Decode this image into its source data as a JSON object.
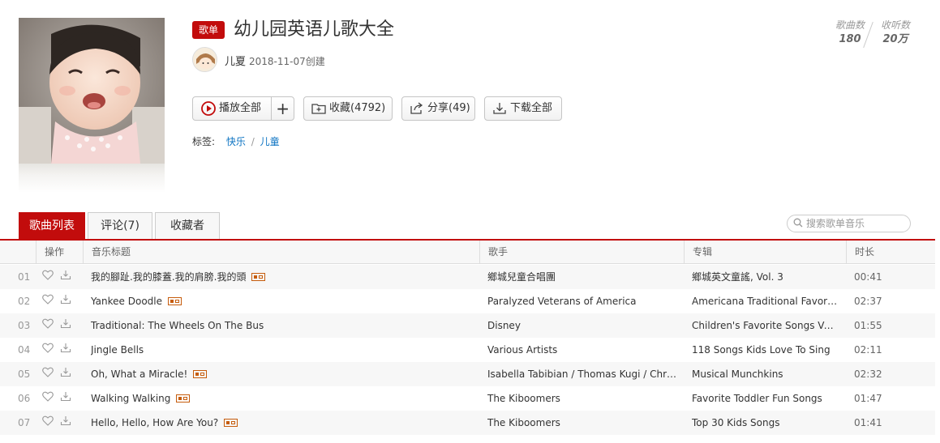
{
  "playlist": {
    "badge": "歌单",
    "title": "幼儿园英语儿歌大全",
    "creator": "儿夏",
    "created": "2018-11-07创建"
  },
  "stats": {
    "songs_label": "歌曲数",
    "songs_value": "180",
    "plays_label": "收听数",
    "plays_value": "20万"
  },
  "actions": {
    "play_all": "播放全部",
    "add": "+",
    "collect": "收藏(4792)",
    "share": "分享(49)",
    "download": "下载全部"
  },
  "tags": {
    "label": "标签:",
    "items": [
      "快乐",
      "儿童"
    ],
    "separator": "/"
  },
  "tabs": [
    "歌曲列表",
    "评论(7)",
    "收藏者"
  ],
  "search": {
    "placeholder": "搜索歌单音乐"
  },
  "table": {
    "headers": {
      "ops": "操作",
      "title": "音乐标题",
      "artist": "歌手",
      "album": "专辑",
      "duration": "时长"
    },
    "rows": [
      {
        "num": "01",
        "title": "我的腳趾.我的膝蓋.我的肩膀.我的頭",
        "mv": true,
        "artist": "鄉城兒童合唱團",
        "album": "鄉城英文童謠, Vol. 3",
        "duration": "00:41"
      },
      {
        "num": "02",
        "title": "Yankee Doodle",
        "mv": true,
        "artist": "Paralyzed Veterans of America",
        "album": "Americana Traditional Favorites",
        "duration": "02:37"
      },
      {
        "num": "03",
        "title": "Traditional: The Wheels On The Bus",
        "mv": false,
        "artist": "Disney",
        "album": "Children's Favorite Songs Volu…",
        "duration": "01:55"
      },
      {
        "num": "04",
        "title": "Jingle Bells",
        "mv": false,
        "artist": "Various Artists",
        "album": "118 Songs Kids Love To Sing",
        "duration": "02:11"
      },
      {
        "num": "05",
        "title": "Oh, What a Miracle!",
        "mv": true,
        "artist": "Isabella Tabibian / Thomas Kugi / Christia…",
        "album": "Musical Munchkins",
        "duration": "02:32"
      },
      {
        "num": "06",
        "title": "Walking Walking",
        "mv": true,
        "artist": "The Kiboomers",
        "album": "Favorite Toddler Fun Songs",
        "duration": "01:47"
      },
      {
        "num": "07",
        "title": "Hello, Hello, How Are You?",
        "mv": true,
        "artist": "The Kiboomers",
        "album": "Top 30 Kids Songs",
        "duration": "01:41"
      }
    ]
  },
  "colors": {
    "accent": "#c20c0c",
    "link": "#0c73c2",
    "mv_icon": "#c65c0c"
  }
}
